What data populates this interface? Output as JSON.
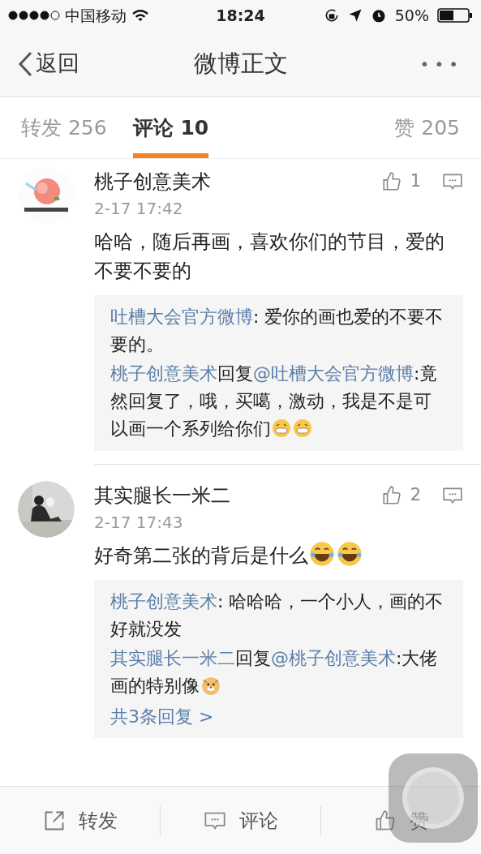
{
  "status_bar": {
    "carrier": "中国移动",
    "time": "18:24",
    "battery": "50%"
  },
  "nav": {
    "back": "返回",
    "title": "微博正文",
    "more": "•••"
  },
  "tabs": [
    {
      "label": "转发 256",
      "selected": false
    },
    {
      "label": "评论 10",
      "selected": true
    },
    {
      "label": "赞 205",
      "selected": false
    }
  ],
  "comments": [
    {
      "name": "桃子创意美术",
      "time": "2-17 17:42",
      "likes": "1",
      "text": [
        {
          "kind": "text",
          "text": "哈哈，随后再画，喜欢你们的节目，爱的不要不要的"
        }
      ],
      "replies": [
        [
          {
            "kind": "link",
            "text": "吐槽大会官方微博"
          },
          {
            "kind": "text",
            "text": ": 爱你的画也爱的不要不要的。"
          }
        ],
        [
          {
            "kind": "link",
            "text": "桃子创意美术"
          },
          {
            "kind": "text",
            "text": "回复"
          },
          {
            "kind": "link",
            "text": "@吐槽大会官方微博"
          },
          {
            "kind": "text",
            "text": ":竟然回复了，哦，买噶，激动，我是不是可以画一个系列给你们"
          },
          {
            "kind": "grin_emoji"
          },
          {
            "kind": "grin_emoji"
          }
        ]
      ]
    },
    {
      "name": "其实腿长一米二",
      "time": "2-17 17:43",
      "likes": "2",
      "text": [
        {
          "kind": "text",
          "text": "好奇第二张的背后是什么"
        },
        {
          "kind": "laugh_emoji"
        },
        {
          "kind": "laugh_emoji"
        }
      ],
      "replies": [
        [
          {
            "kind": "link",
            "text": "桃子创意美术"
          },
          {
            "kind": "text",
            "text": ": 哈哈哈，一个小人，画的不好就没发"
          }
        ],
        [
          {
            "kind": "link",
            "text": "其实腿长一米二"
          },
          {
            "kind": "text",
            "text": "回复"
          },
          {
            "kind": "link",
            "text": "@桃子创意美术"
          },
          {
            "kind": "text",
            "text": ":"
          },
          {
            "kind": "text",
            "text": "大佬画的特别像"
          },
          {
            "kind": "doge_emoji"
          }
        ]
      ],
      "more_replies": "共3条回复 >"
    }
  ],
  "toolbar": [
    {
      "kind": "share",
      "label": "转发"
    },
    {
      "kind": "comment",
      "label": "评论"
    },
    {
      "kind": "like",
      "label": "赞"
    }
  ]
}
